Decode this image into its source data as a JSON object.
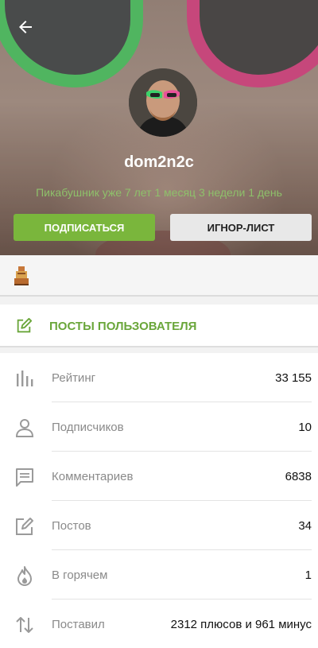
{
  "header": {
    "back_icon": "arrow-left-icon",
    "username": "dom2n2c",
    "member_since": "Пикабушник уже 7 лет 1 месяц 3 недели 1 день",
    "subscribe_label": "ПОДПИСАТЬСЯ",
    "ignore_label": "ИГНОР-ЛИСТ"
  },
  "awards": {
    "items": [
      "award-badge-icon"
    ]
  },
  "posts_link": {
    "label": "ПОСТЫ ПОЛЬЗОВАТЕЛЯ",
    "icon": "edit-icon"
  },
  "stats": [
    {
      "icon": "rating-bars-icon",
      "label": "Рейтинг",
      "value": "33 155"
    },
    {
      "icon": "person-icon",
      "label": "Подписчиков",
      "value": "10"
    },
    {
      "icon": "comment-icon",
      "label": "Комментариев",
      "value": "6838"
    },
    {
      "icon": "edit-icon",
      "label": "Постов",
      "value": "34"
    },
    {
      "icon": "fire-icon",
      "label": "В горячем",
      "value": "1"
    },
    {
      "icon": "vote-arrows-icon",
      "label": "Поставил",
      "value": "2312 плюсов и 961 минус"
    }
  ],
  "colors": {
    "accent_green": "#7ab63c",
    "since_text": "#8ec06a",
    "icon_gray": "#9a9a9a"
  }
}
